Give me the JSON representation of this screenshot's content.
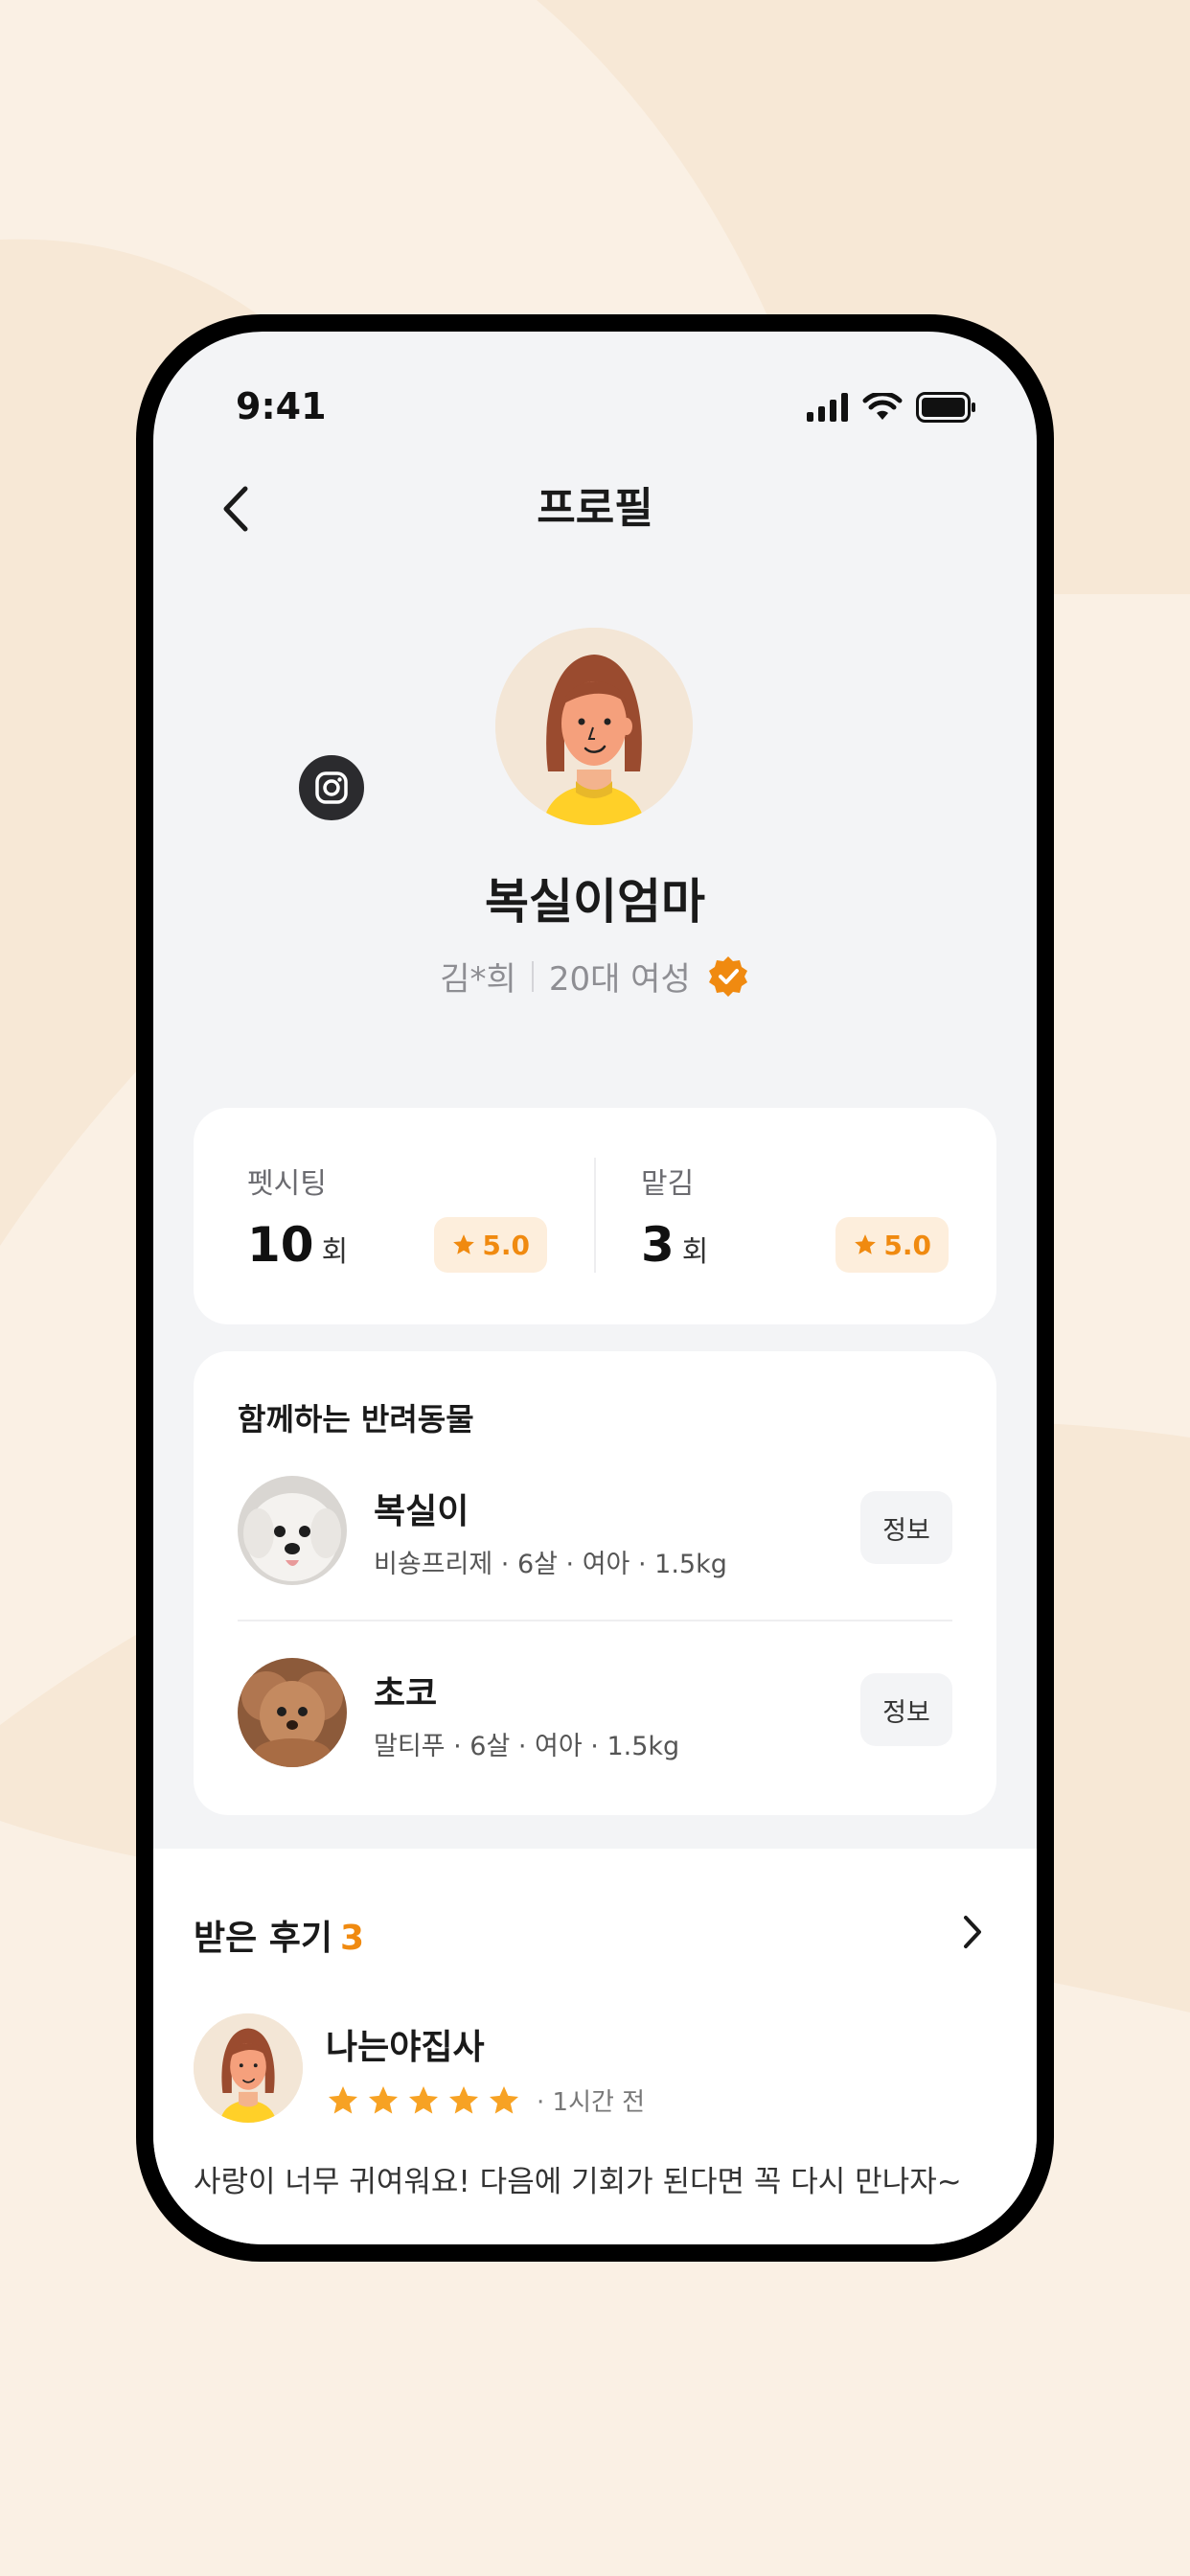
{
  "status_bar": {
    "time": "9:41"
  },
  "header": {
    "title": "프로필"
  },
  "profile": {
    "nickname": "복실이엄마",
    "real_name": "김*희",
    "demographic": "20대 여성"
  },
  "stats": {
    "petsitting": {
      "label": "펫시팅",
      "count": "10",
      "unit": "회",
      "rating": "5.0"
    },
    "entrust": {
      "label": "맡김",
      "count": "3",
      "unit": "회",
      "rating": "5.0"
    }
  },
  "pets": {
    "title": "함께하는 반려동물",
    "items": [
      {
        "name": "복실이",
        "desc": "비숑프리제 · 6살 · 여아 · 1.5kg",
        "button": "정보"
      },
      {
        "name": "초코",
        "desc": "말티푸 · 6살 · 여아 · 1.5kg",
        "button": "정보"
      }
    ]
  },
  "reviews": {
    "title": "받은 후기",
    "count": "3",
    "latest": {
      "author": "나는야집사",
      "rating": 5,
      "time": "· 1시간 전",
      "text": "사랑이 너무 귀여워요! 다음에 기회가 된다면 꼭 다시 만나자~"
    }
  },
  "colors": {
    "accent": "#F08A10",
    "background": "#FAF0E4",
    "screen_bg": "#F3F4F6",
    "card_bg": "#FFFFFF",
    "chip_bg": "#FDEEDC"
  }
}
